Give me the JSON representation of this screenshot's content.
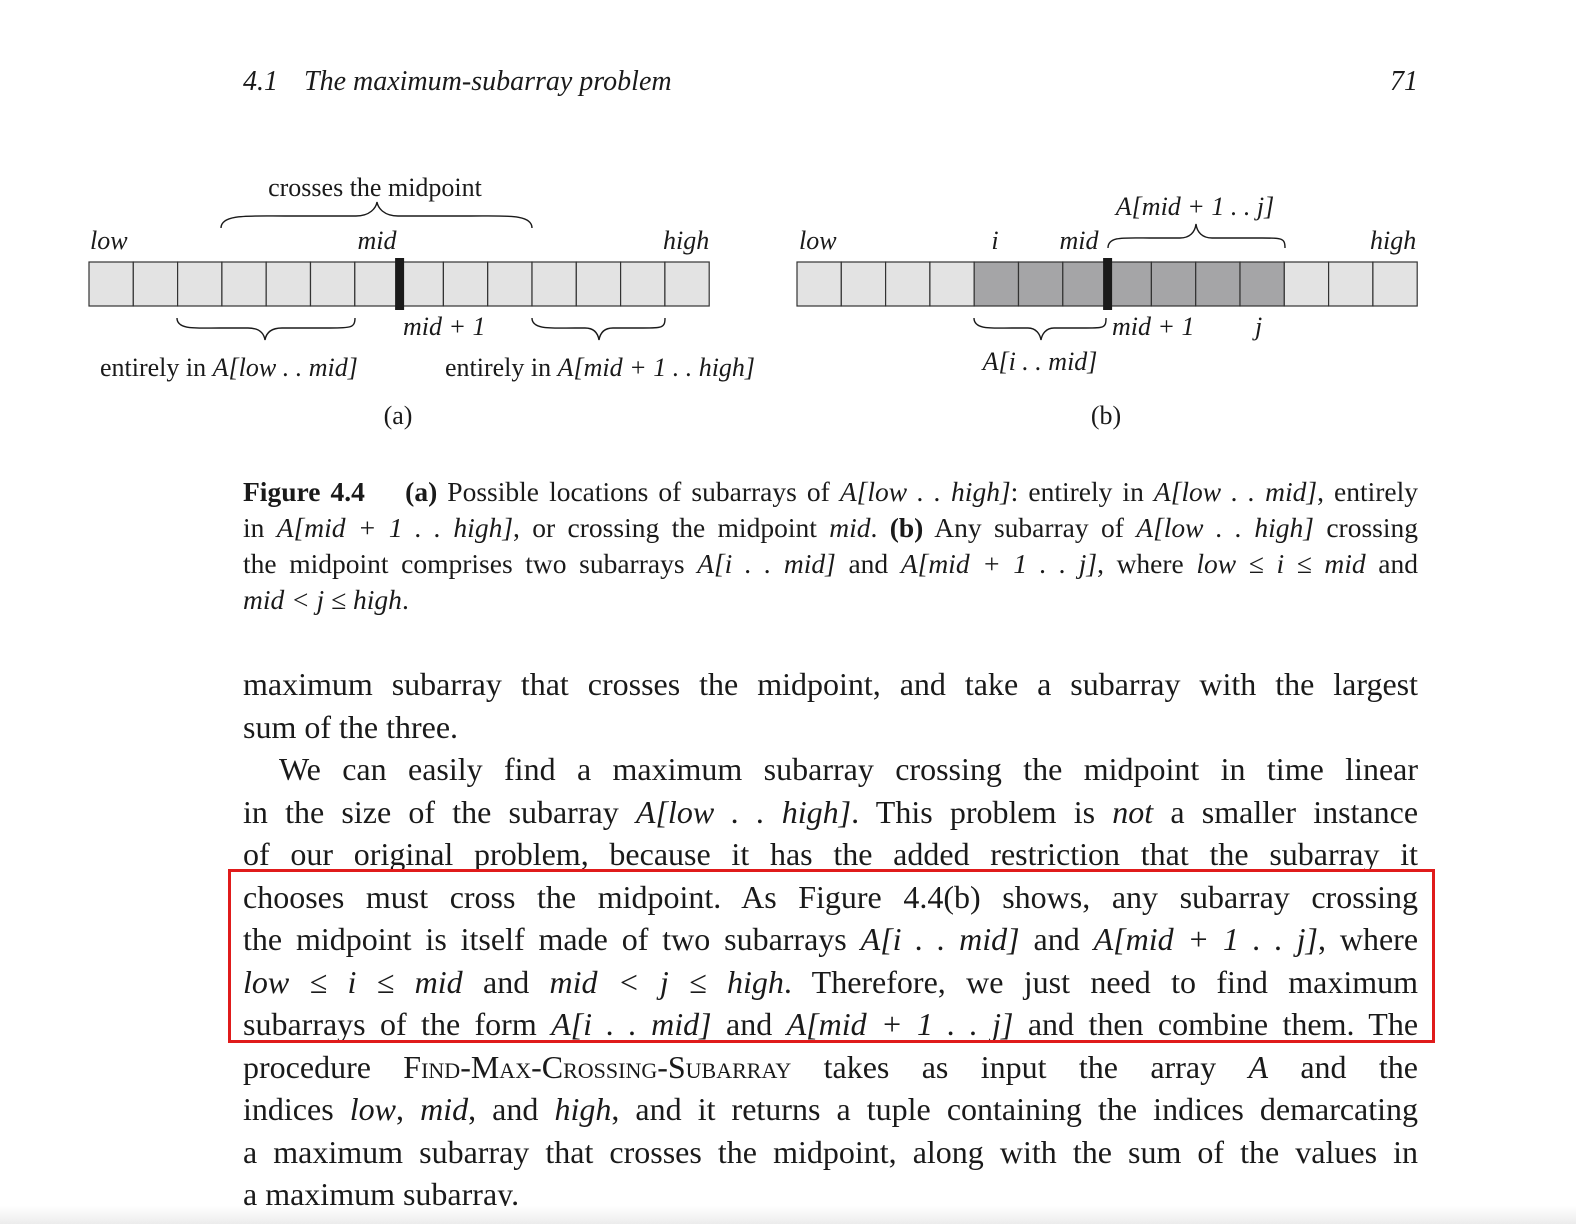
{
  "running_head": {
    "section_number": "4.1",
    "section_title": "The maximum-subarray problem",
    "page_number": "71"
  },
  "figure": {
    "a": {
      "top_label": "crosses the midpoint",
      "low": "low",
      "mid": "mid",
      "high": "high",
      "mid_plus_1": "mid + 1",
      "left_label_prefix": "entirely in ",
      "left_label_A": "A",
      "left_label_range": "[low . . mid]",
      "right_label_prefix": "entirely in ",
      "right_label_A": "A",
      "right_label_range": "[mid + 1 . . high]",
      "tag": "(a)"
    },
    "b": {
      "top_label": "A[mid + 1 . . j]",
      "low": "low",
      "i": "i",
      "mid": "mid",
      "high": "high",
      "mid_plus_1": "mid + 1",
      "j": "j",
      "bottom_label": "A[i . . mid]",
      "tag": "(b)"
    },
    "colors": {
      "cell_fill": "#e3e3e3",
      "shaded_fill": "#a5a5a7",
      "divider": "#1a1a1a"
    }
  },
  "caption": {
    "label": "Figure 4.4",
    "line1": [
      "(a)",
      " Possible locations of subarrays of ",
      "A",
      "[low . . high]",
      ": entirely in ",
      "A",
      "[low . . mid]",
      ", entirely"
    ],
    "line2": [
      "in ",
      "A",
      "[mid + 1 . . high]",
      ", or crossing the midpoint ",
      "mid",
      ".  ",
      "(b)",
      " Any subarray of ",
      "A",
      "[low . . high]",
      " crossing"
    ],
    "line3": [
      "the midpoint comprises two subarrays ",
      "A",
      "[i . . mid]",
      " and ",
      "A",
      "[mid + 1 . . j]",
      ", where ",
      "low ≤ i ≤ mid",
      " and"
    ],
    "line4": [
      "mid < j ≤ high",
      "."
    ]
  },
  "body": {
    "lines": [
      "maximum subarray that crosses the midpoint, and take a subarray with the largest",
      "sum of the three.",
      "We can easily find a maximum subarray crossing the midpoint in time linear",
      "in the size of the subarray A[low . . high]. This problem is not a smaller instance",
      "of our original problem, because it has the added restriction that the subarray it",
      "chooses must cross the midpoint. As Figure 4.4(b) shows, any subarray crossing",
      "the midpoint is itself made of two subarrays A[i . . mid] and A[mid + 1 . . j], where",
      "low ≤ i ≤ mid and mid < j ≤ high. Therefore, we just need to find maximum",
      "subarrays of the form A[i . . mid] and A[mid + 1 . . j] and then combine them. The",
      "procedure Find-Max-Crossing-Subarray takes as input the array A and the",
      "indices low, mid, and high, and it returns a tuple containing the indices demarcating",
      "a maximum subarray that crosses the midpoint, along with the sum of the values in",
      "a maximum subarray."
    ],
    "highlight_color": "#e01b1b"
  }
}
